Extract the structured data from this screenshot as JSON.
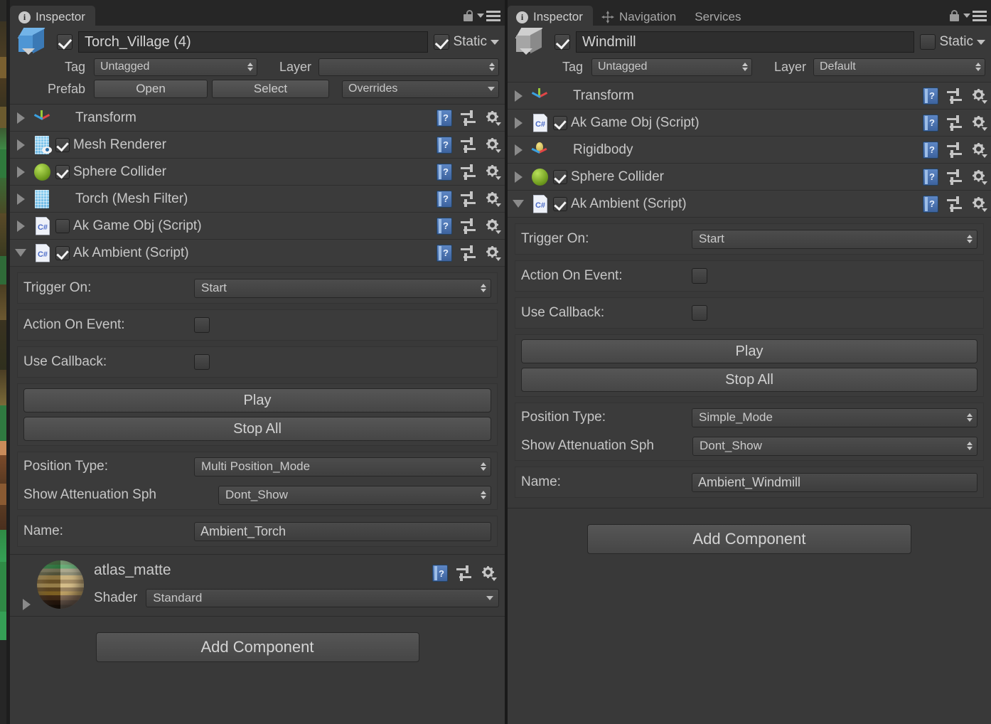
{
  "left_panel": {
    "tab": {
      "label": "Inspector",
      "icon": "info-icon"
    },
    "lock_state": "unlocked",
    "object": {
      "enabled": true,
      "name": "Torch_Village (4)",
      "static_checked": true,
      "static_label": "Static",
      "tag_label": "Tag",
      "tag_value": "Untagged",
      "layer_label": "Layer",
      "layer_value": "",
      "prefab_label": "Prefab",
      "prefab_open": "Open",
      "prefab_select": "Select",
      "prefab_overrides": "Overrides"
    },
    "components": [
      {
        "name": "Transform",
        "icon": "transform-icon",
        "expanded": false,
        "has_checkbox": false
      },
      {
        "name": "Mesh Renderer",
        "icon": "mesh-renderer-icon",
        "expanded": false,
        "has_checkbox": true,
        "checked": true
      },
      {
        "name": "Sphere Collider",
        "icon": "sphere-collider-icon",
        "expanded": false,
        "has_checkbox": true,
        "checked": true
      },
      {
        "name": "Torch (Mesh Filter)",
        "icon": "mesh-filter-icon",
        "expanded": false,
        "has_checkbox": false
      },
      {
        "name": "Ak Game Obj (Script)",
        "icon": "csharp-script-icon",
        "expanded": false,
        "has_checkbox": true,
        "checked": false
      },
      {
        "name": "Ak Ambient (Script)",
        "icon": "csharp-script-icon",
        "expanded": true,
        "has_checkbox": true,
        "checked": true
      }
    ],
    "ak_ambient": {
      "trigger_on_label": "Trigger On:",
      "trigger_on_value": "Start",
      "action_on_event_label": "Action On Event:",
      "action_on_event_checked": false,
      "use_callback_label": "Use Callback:",
      "use_callback_checked": false,
      "play_button": "Play",
      "stop_all_button": "Stop All",
      "position_type_label": "Position Type:",
      "position_type_value": "Multi Position_Mode",
      "show_attenuation_label": "Show Attenuation Sph",
      "show_attenuation_value": "Dont_Show",
      "name_label": "Name:",
      "name_value": "Ambient_Torch"
    },
    "material": {
      "name": "atlas_matte",
      "shader_label": "Shader",
      "shader_value": "Standard"
    },
    "add_component": "Add Component"
  },
  "right_panel": {
    "tabs": [
      {
        "label": "Inspector",
        "icon": "info-icon",
        "active": true
      },
      {
        "label": "Navigation",
        "icon": "navigation-icon",
        "active": false
      },
      {
        "label": "Services",
        "icon": "",
        "active": false
      }
    ],
    "lock_state": "locked",
    "object": {
      "enabled": true,
      "name": "Windmill",
      "static_checked": false,
      "static_label": "Static",
      "tag_label": "Tag",
      "tag_value": "Untagged",
      "layer_label": "Layer",
      "layer_value": "Default"
    },
    "components": [
      {
        "name": "Transform",
        "icon": "transform-icon",
        "expanded": false,
        "has_checkbox": false
      },
      {
        "name": "Ak Game Obj (Script)",
        "icon": "csharp-script-icon",
        "expanded": false,
        "has_checkbox": true,
        "checked": true
      },
      {
        "name": "Rigidbody",
        "icon": "rigidbody-icon",
        "expanded": false,
        "has_checkbox": false
      },
      {
        "name": "Sphere Collider",
        "icon": "sphere-collider-icon",
        "expanded": false,
        "has_checkbox": true,
        "checked": true
      },
      {
        "name": "Ak Ambient (Script)",
        "icon": "csharp-script-icon",
        "expanded": true,
        "has_checkbox": true,
        "checked": true
      }
    ],
    "ak_ambient": {
      "trigger_on_label": "Trigger On:",
      "trigger_on_value": "Start",
      "action_on_event_label": "Action On Event:",
      "action_on_event_checked": false,
      "use_callback_label": "Use Callback:",
      "use_callback_checked": false,
      "play_button": "Play",
      "stop_all_button": "Stop All",
      "position_type_label": "Position Type:",
      "position_type_value": "Simple_Mode",
      "show_attenuation_label": "Show Attenuation Sph",
      "show_attenuation_value": "Dont_Show",
      "name_label": "Name:",
      "name_value": "Ambient_Windmill"
    },
    "add_component": "Add Component"
  },
  "colors": {
    "panel_bg": "#393939",
    "tabbar_bg": "#262626",
    "prefab_blue": "#4f96d4",
    "script_blue": "#4b6bc8",
    "collider_green": "#6f9c1e"
  }
}
